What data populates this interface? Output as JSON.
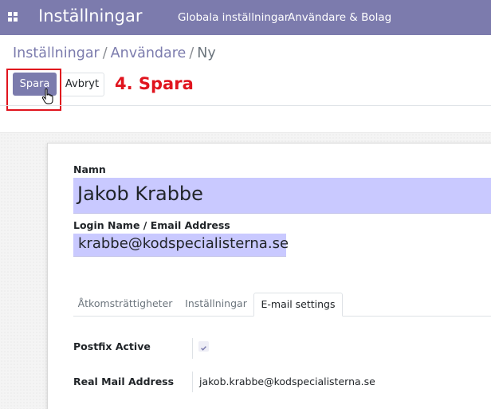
{
  "navbar": {
    "app_title": "Inställningar",
    "menu_items": [
      "Globala inställningar",
      "Användare & Bolag"
    ]
  },
  "breadcrumb": {
    "items": [
      "Inställningar",
      "Användare",
      "Ny"
    ],
    "separator": "/"
  },
  "actions": {
    "save_label": "Spara",
    "cancel_label": "Avbryt"
  },
  "annotation": {
    "text": "4. Spara",
    "color": "#e0141e"
  },
  "form": {
    "name_label": "Namn",
    "name_value": "Jakob Krabbe",
    "login_label": "Login Name / Email Address",
    "login_value": "krabbe@kodspecialisterna.se",
    "tabs": [
      "Åtkomsträttigheter",
      "Inställningar",
      "E-mail settings"
    ],
    "active_tab": "E-mail settings",
    "postfix_label": "Postfix Active",
    "postfix_checked": true,
    "real_mail_label": "Real Mail Address",
    "real_mail_value": "jakob.krabbe@kodspecialisterna.se"
  },
  "colors": {
    "brand": "#7c7bad",
    "input_highlight": "#c9c9ff",
    "annotation_red": "#e0141e"
  },
  "icons": [
    "apps-grid-icon",
    "hand-pointer-icon",
    "check-icon"
  ]
}
